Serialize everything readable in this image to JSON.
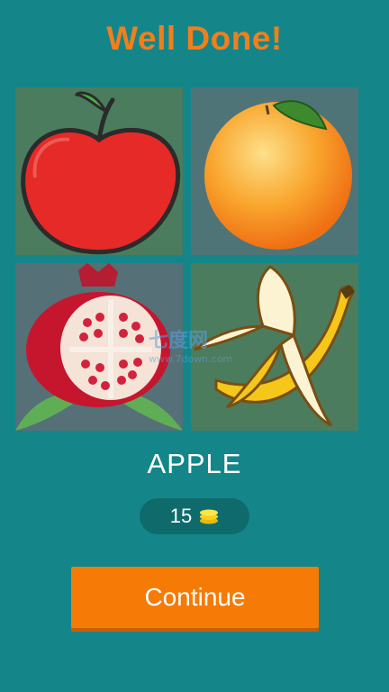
{
  "header": {
    "title": "Well Done!"
  },
  "tiles": [
    {
      "name": "apple",
      "icon": "apple-image"
    },
    {
      "name": "orange",
      "icon": "orange-image"
    },
    {
      "name": "pomegranate",
      "icon": "pomegranate-image"
    },
    {
      "name": "banana",
      "icon": "banana-image"
    }
  ],
  "watermark": {
    "text": "七度网",
    "url": "www.7down.com"
  },
  "answer": {
    "word": "APPLE"
  },
  "coins": {
    "value": "15",
    "icon": "coins-icon"
  },
  "actions": {
    "continue_label": "Continue"
  },
  "colors": {
    "background": "#14868a",
    "title": "#f07f1c",
    "button": "#f67b06",
    "coin_pill": "#0f6a6c"
  }
}
